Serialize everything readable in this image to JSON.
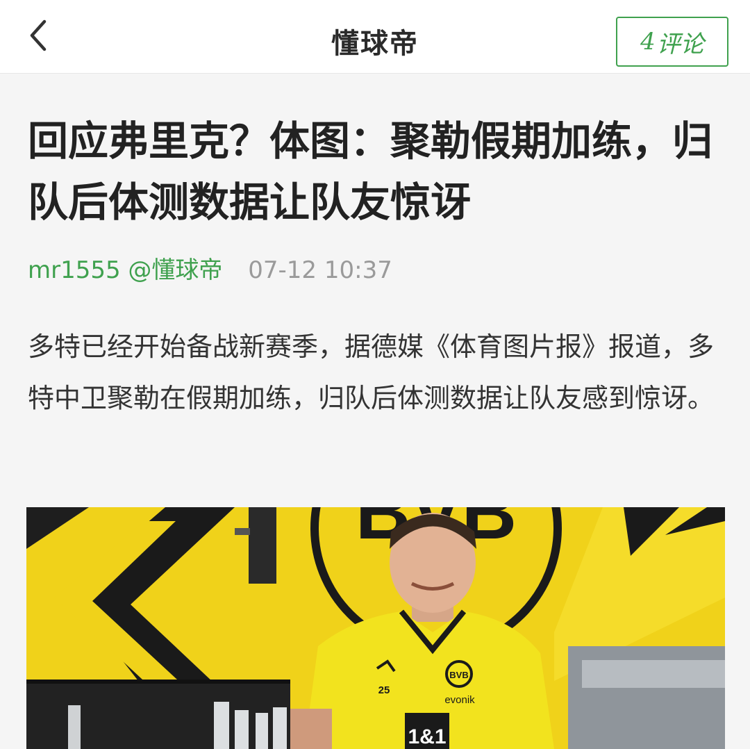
{
  "header": {
    "brand": "懂球帝",
    "comment_count": "4",
    "comment_label": "评论"
  },
  "article": {
    "title": "回应弗里克？体图：聚勒假期加练，归队后体测数据让队友惊讶",
    "author": "mr1555 @懂球帝",
    "time": "07-12 10:37",
    "body": "多特已经开始备战新赛季，据德媒《体育图片报》报道，多特中卫聚勒在假期加练，归队后体测数据让队友感到惊讶。",
    "image": {
      "crest_text": "BVB",
      "kit_number": "25",
      "sponsor_text": "1&1",
      "kit_brand": "evonik"
    }
  },
  "colors": {
    "accent_green": "#3fa14e",
    "bvb_yellow": "#f0d21a",
    "text_dark": "#222222",
    "meta_gray": "#9a9a9a"
  },
  "icons": {
    "back": "chevron-left-icon"
  }
}
